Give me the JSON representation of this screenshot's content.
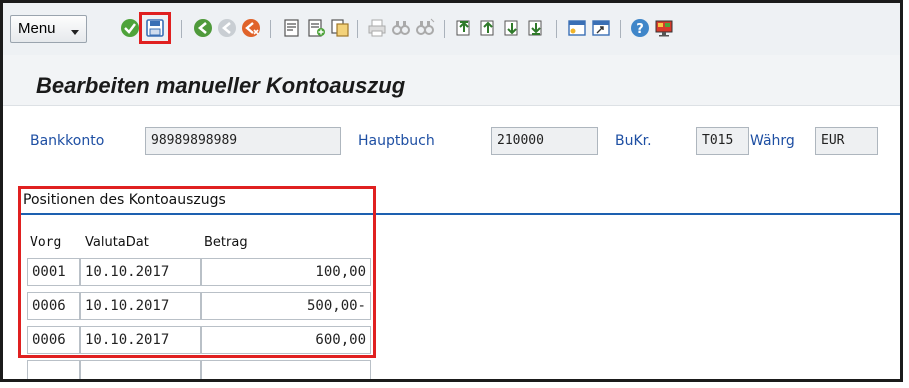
{
  "toolbar": {
    "menu_label": "Menu",
    "icons": [
      "check-icon",
      "save-icon",
      "back-icon",
      "exit-icon",
      "cancel-icon",
      "create-icon",
      "create-plus-icon",
      "copy-icon",
      "print-icon",
      "find-icon",
      "find-next-icon",
      "first-page-icon",
      "previous-page-icon",
      "next-page-icon",
      "last-page-icon",
      "new-session-icon",
      "shortcut-icon",
      "help-icon",
      "customize-layout-icon"
    ],
    "highlight_color": "#e02020"
  },
  "screen": {
    "title": "Bearbeiten manueller Kontoauszug"
  },
  "header": {
    "bankkonto_label": "Bankkonto",
    "bankkonto_value": "98989898989",
    "hauptbuch_label": "Hauptbuch",
    "hauptbuch_value": "210000",
    "bukr_label": "BuKr.",
    "bukr_value": "T015",
    "waehrg_label": "Währg",
    "waehrg_value": "EUR"
  },
  "positions": {
    "title": "Positionen des Kontoauszugs",
    "columns": [
      "Vorg",
      "ValutaDat",
      "Betrag"
    ],
    "rows": [
      {
        "vorg": "0001",
        "valutadat": "10.10.2017",
        "betrag": "100,00"
      },
      {
        "vorg": "0006",
        "valutadat": "10.10.2017",
        "betrag": "500,00-"
      },
      {
        "vorg": "0006",
        "valutadat": "10.10.2017",
        "betrag": "600,00"
      },
      {
        "vorg": "",
        "valutadat": "",
        "betrag": ""
      }
    ]
  },
  "colors": {
    "label_blue": "#1e4fa3",
    "section_line": "#1d60b0",
    "highlight": "#e02020"
  }
}
